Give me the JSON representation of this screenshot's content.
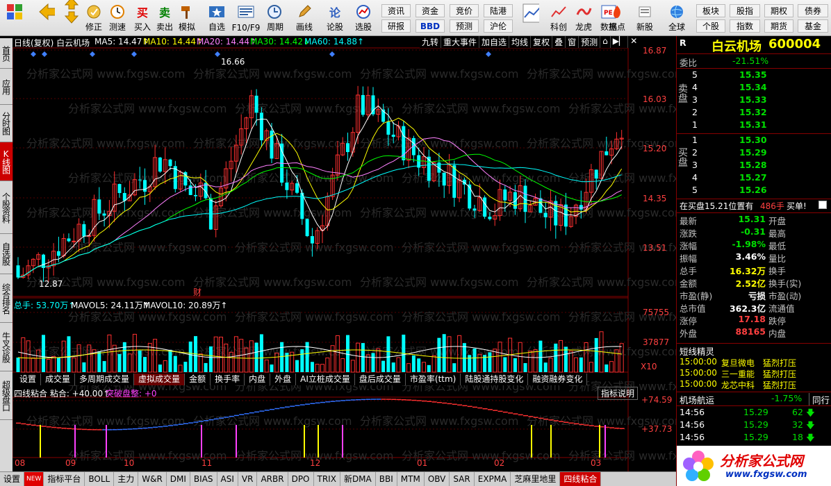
{
  "toolbar": {
    "items": [
      {
        "label": "",
        "icon": "grid-icon"
      },
      {
        "label": "",
        "icon": "back-arrow-icon"
      },
      {
        "label": "",
        "icon": "up-down-arrows-icon"
      },
      {
        "label": "修正",
        "icon": "adjust-icon"
      },
      {
        "label": "测速",
        "icon": "clock-icon"
      },
      {
        "label": "买入",
        "icon": "buy-icon"
      },
      {
        "label": "卖出",
        "icon": "sell-icon"
      },
      {
        "label": "模拟",
        "icon": "hammer-icon"
      },
      {
        "label": "自选",
        "icon": "star-icon"
      },
      {
        "label": "F10/F9",
        "icon": "f10-icon"
      },
      {
        "label": "周期",
        "icon": "period-icon"
      },
      {
        "label": "画线",
        "icon": "pencil-icon"
      },
      {
        "label": "论股",
        "icon": "forum-icon"
      },
      {
        "label": "选股",
        "icon": "stock-pick-icon"
      },
      {
        "label": "",
        "icon": "chart-icon"
      },
      {
        "label": "科创",
        "icon": "tech-icon"
      },
      {
        "label": "龙虎",
        "icon": "dragon-icon"
      },
      {
        "label": "数据",
        "icon": "pe-icon"
      },
      {
        "label": "热点",
        "icon": "fire-icon"
      },
      {
        "label": "新股",
        "icon": "new-stock-icon"
      },
      {
        "label": "全球",
        "icon": "globe-icon"
      }
    ],
    "small_buttons": [
      "资讯",
      "资金",
      "竞价",
      "陆港",
      "研报",
      "BBD",
      "预测",
      "沪伦",
      "板块",
      "股指",
      "期权",
      "债券",
      "个股",
      "指数",
      "期货",
      "基金"
    ],
    "buy_char": "买",
    "sell_char": "卖",
    "forum_char": "论"
  },
  "left_tabs": [
    "首页",
    "应用",
    "分时图",
    "K线图",
    "个股资料",
    "自选股",
    "综合排名",
    "牛叉诊股",
    "超级盘口"
  ],
  "chart": {
    "header_text": "日线(复权)  白云机场",
    "ma5": "MA5: 14.47↑",
    "ma10": "MA10: 14.44↑",
    "ma20": "MA20: 14.44↑",
    "ma30": "MA30: 14.42↓",
    "ma60": "MA60: 14.88↑",
    "buttons": [
      "九转",
      "重大事件",
      "加自选",
      "均线",
      "复权",
      "叠",
      "窗",
      "预测"
    ],
    "price_axis": [
      "16.87",
      "16.03",
      "15.20",
      "14.35",
      "13.51"
    ],
    "high_label": "16.66",
    "low_label": "12.87",
    "cai_label": "财",
    "watermark": "分析家公式网 www.fxgsw.com",
    "volume_header": "总手: 53.70万↑",
    "mavol5": "MAVOL5: 24.11万↑",
    "mavol10": "MAVOL10: 20.89万↑",
    "vol_axis": [
      "75755",
      "37877"
    ],
    "vol_unit": "X10",
    "sub_tabs": [
      "设置",
      "成交量",
      "多周期成交量",
      "虚拟成交量",
      "金额",
      "换手率",
      "内盘",
      "外盘",
      "AI立桩成交量",
      "盘后成交量",
      "市盈率(ttm)",
      "陆股通持股变化",
      "融资融券变化"
    ],
    "indicator_header": "四线粘合  粘合: +40.00↑",
    "indicator_break": "突破盘整: +0",
    "indicator_help": "指标说明",
    "ind_axis": [
      "+74.59",
      "+37.73"
    ],
    "months": [
      "08",
      "09",
      "10",
      "11",
      "12",
      "01",
      "02",
      "03"
    ]
  },
  "bottom_tabs": [
    "设置",
    "NEW",
    "指标平台",
    "BOLL",
    "主力",
    "W&R",
    "DMI",
    "BIAS",
    "ASI",
    "VR",
    "ARBR",
    "DPO",
    "TRIX",
    "新DMA",
    "BBI",
    "MTM",
    "OBV",
    "SAR",
    "EXPMA",
    "芝麻里地里",
    "四线粘合"
  ],
  "quote": {
    "marker": "R",
    "name": "白云机场",
    "code": "600004",
    "weibi_label": "委比",
    "weibi": "-21.51%",
    "sell_label": "卖盘",
    "buy_label": "买盘",
    "asks": [
      {
        "lvl": "5",
        "price": "15.35"
      },
      {
        "lvl": "4",
        "price": "15.34"
      },
      {
        "lvl": "3",
        "price": "15.33"
      },
      {
        "lvl": "2",
        "price": "15.32"
      },
      {
        "lvl": "1",
        "price": "15.31"
      }
    ],
    "bids": [
      {
        "lvl": "1",
        "price": "15.30"
      },
      {
        "lvl": "2",
        "price": "15.29"
      },
      {
        "lvl": "3",
        "price": "15.28"
      },
      {
        "lvl": "4",
        "price": "15.27"
      },
      {
        "lvl": "5",
        "price": "15.26"
      }
    ],
    "queue_text": "在买盘15.21位置有",
    "queue_amt": "486手",
    "queue_action": "买单!",
    "stats": [
      {
        "k1": "最新",
        "v1": "15.31",
        "k2": "开盘",
        "c1": "green"
      },
      {
        "k1": "涨跌",
        "v1": "-0.31",
        "k2": "最高",
        "c1": "green"
      },
      {
        "k1": "涨幅",
        "v1": "-1.98%",
        "k2": "最低",
        "c1": "green"
      },
      {
        "k1": "振幅",
        "v1": "3.46%",
        "k2": "量比",
        "c1": "white"
      },
      {
        "k1": "总手",
        "v1": "16.32万",
        "k2": "换手",
        "c1": "yellow"
      },
      {
        "k1": "金额",
        "v1": "2.52亿",
        "k2": "换手(实)",
        "c1": "yellow"
      },
      {
        "k1": "市盈(静)",
        "v1": "亏损",
        "k2": "市盈(动)",
        "c1": "white"
      },
      {
        "k1": "总市值",
        "v1": "362.3亿",
        "k2": "流通值",
        "c1": "white"
      },
      {
        "k1": "涨停",
        "v1": "17.18",
        "k2": "跌停",
        "c1": "red"
      },
      {
        "k1": "外盘",
        "v1": "88165",
        "k2": "内盘",
        "c1": "red"
      }
    ],
    "elf_title": "短线精灵",
    "elf": [
      {
        "time": "15:00:00",
        "name": "复旦微电",
        "act": "猛烈打压"
      },
      {
        "time": "15:00:00",
        "name": "三一重能",
        "act": "猛烈打压"
      },
      {
        "time": "15:00:00",
        "name": "龙芯中科",
        "act": "猛烈打压"
      }
    ],
    "sector_name": "机场航运",
    "sector_chg": "-1.75%",
    "sector_tab": "同行",
    "ticks": [
      {
        "time": "14:56",
        "price": "15.29",
        "vol": "62"
      },
      {
        "time": "14:56",
        "price": "15.29",
        "vol": "32"
      },
      {
        "time": "14:56",
        "price": "15.29",
        "vol": "18"
      }
    ],
    "logo_text": "分析家公式网",
    "logo_url": "www.fxgsw.com"
  }
}
